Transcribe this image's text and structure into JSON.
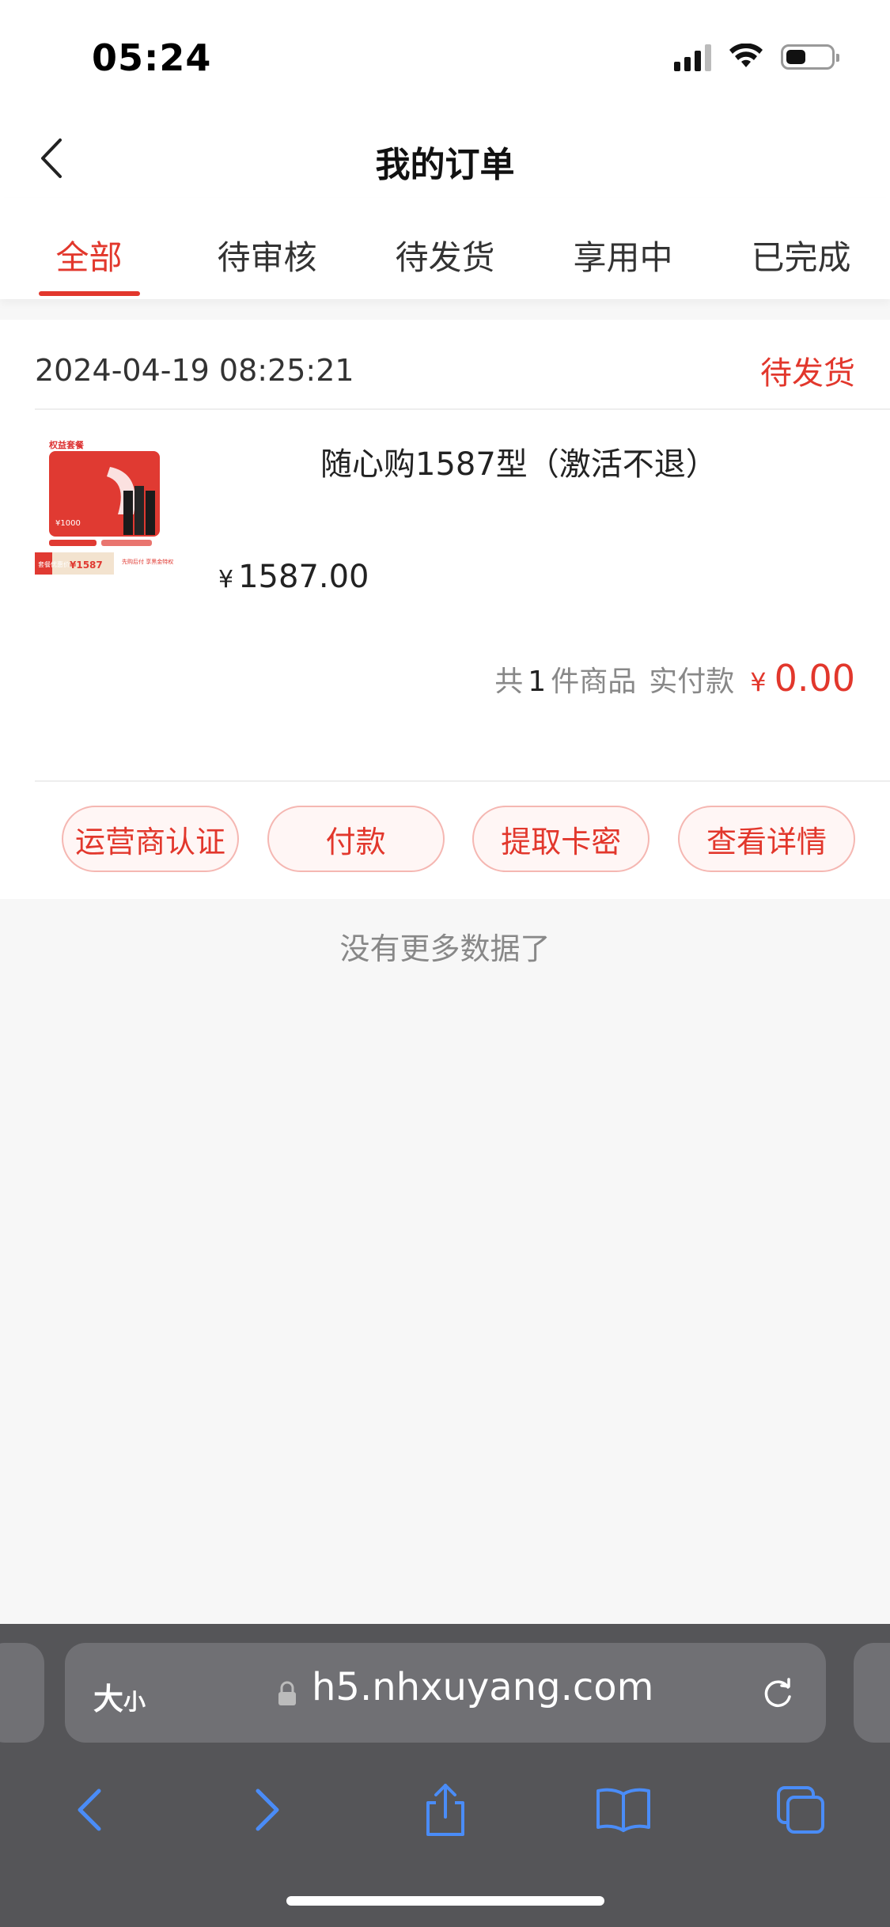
{
  "status_bar": {
    "time": "05:24",
    "battery_percent": 45
  },
  "nav": {
    "title": "我的订单",
    "back_icon": "chevron-left-icon"
  },
  "tabs": [
    {
      "label": "全部",
      "active": true
    },
    {
      "label": "待审核",
      "active": false
    },
    {
      "label": "待发货",
      "active": false
    },
    {
      "label": "享用中",
      "active": false
    },
    {
      "label": "已完成",
      "active": false
    }
  ],
  "order": {
    "date": "2024-04-19 08:25:21",
    "status": "待发货",
    "product": {
      "name": "随心购1587型（激活不退）",
      "currency": "¥",
      "price": "1587.00",
      "image_texts": {
        "badge": "权益套餐",
        "card_value": "¥1000",
        "bottom_left": "套餐优惠价",
        "bottom_price": "¥1587",
        "bottom_right": "先购后付 享黑金特权"
      }
    },
    "summary": {
      "prefix": "共",
      "count": "1",
      "suffix": "件商品",
      "paid_label": "实付款",
      "currency": "¥",
      "paid_amount": "0.00"
    },
    "actions": [
      {
        "label": "运营商认证"
      },
      {
        "label": "付款"
      },
      {
        "label": "提取卡密"
      },
      {
        "label": "查看详情"
      }
    ]
  },
  "list_footer": "没有更多数据了",
  "browser": {
    "text_size_label": "大",
    "text_size_small": "小",
    "url": "h5.nhxuyang.com",
    "colors": {
      "bar": "#555558",
      "field": "#707074",
      "icons": "#4a8cf7"
    }
  },
  "colors": {
    "accent": "#e2372c",
    "background": "#f7f7f7"
  }
}
